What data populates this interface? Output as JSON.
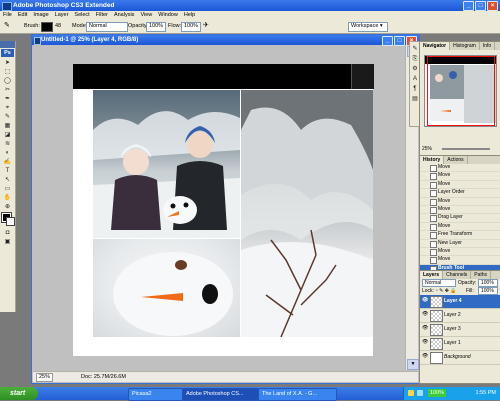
{
  "app": {
    "title": "Adobe Photoshop CS3 Extended"
  },
  "menu": [
    "File",
    "Edit",
    "Image",
    "Layer",
    "Select",
    "Filter",
    "Analysis",
    "View",
    "Window",
    "Help"
  ],
  "options_bar": {
    "brush_label": "Brush:",
    "brush_size": "48",
    "mode_label": "Mode:",
    "mode_value": "Normal",
    "opacity_label": "Opacity:",
    "opacity_value": "100%",
    "flow_label": "Flow:",
    "flow_value": "100%",
    "workspace": "Workspace ▾"
  },
  "tools": {
    "ps_label": "Ps",
    "glyphs": [
      "➤",
      "⬚",
      "◯",
      "✂",
      "✒",
      "⌖",
      "✎",
      "▦",
      "◪",
      "≋",
      "◐",
      "✍",
      "T",
      "↖",
      "▭",
      "✋",
      "⊕"
    ]
  },
  "document": {
    "title": "Untitled-1 @ 25% (Layer 4, RGB/8)",
    "zoom": "25%",
    "doc_info": "Doc: 25.7M/26.6M"
  },
  "navigator": {
    "tabs": [
      "Navigator",
      "Histogram",
      "Info"
    ],
    "zoom": "25%"
  },
  "history": {
    "tabs": [
      "History",
      "Actions"
    ],
    "items": [
      "Move",
      "Move",
      "Move",
      "Layer Order",
      "Move",
      "Move",
      "Drag Layer",
      "Move",
      "Free Transform",
      "New Layer",
      "Move",
      "Move",
      "Brush Tool"
    ],
    "selected_index": 12
  },
  "layers": {
    "tabs": [
      "Layers",
      "Channels",
      "Paths"
    ],
    "blend_mode": "Normal",
    "opacity_label": "Opacity:",
    "opacity_value": "100%",
    "lock_label": "Lock:",
    "fill_label": "Fill:",
    "fill_value": "100%",
    "items": [
      "Layer 4",
      "Layer 2",
      "Layer 3",
      "Layer 1",
      "Background"
    ],
    "selected_index": 0
  },
  "taskbar": {
    "start_label": "start",
    "items": [
      "Picasa2",
      "Adobe Photoshop CS...",
      "The Land of X.A. - G..."
    ],
    "active_index": 1,
    "battery": "100%",
    "clock": "1:55 PM"
  },
  "colors": {
    "xp_blue": "#245ed6",
    "selection_blue": "#316ac5",
    "panel_bg": "#ece9d8"
  }
}
